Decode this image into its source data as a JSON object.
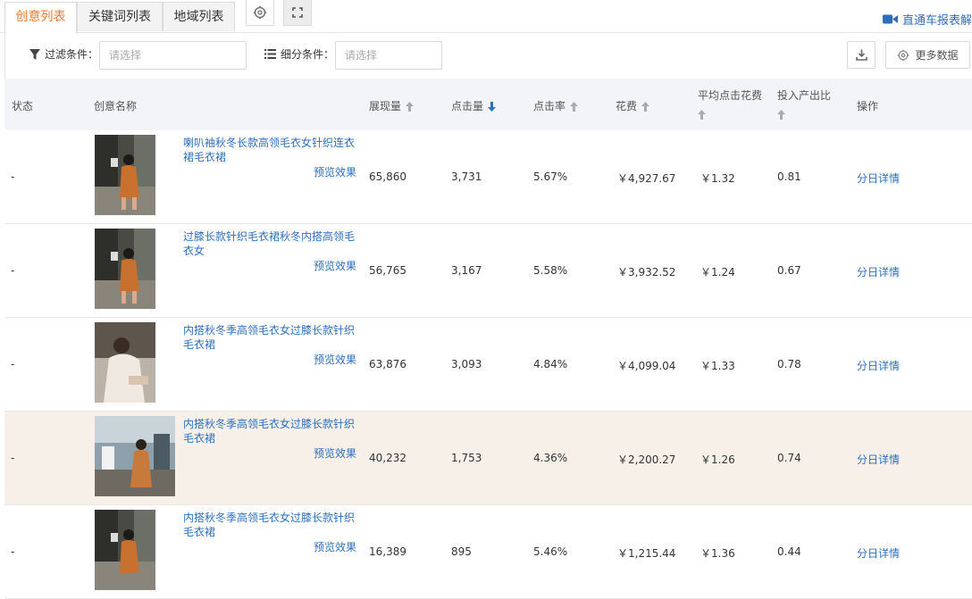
{
  "tabs": [
    {
      "label": "创意列表",
      "active": true
    },
    {
      "label": "关键词列表",
      "active": false
    },
    {
      "label": "地域列表",
      "active": false
    }
  ],
  "report_link": "直通车报表解读",
  "filters": {
    "filter_label": "过滤条件：",
    "filter_placeholder": "请选择",
    "segment_label": "细分条件：",
    "segment_placeholder": "请选择",
    "more_data_label": "更多数据"
  },
  "table": {
    "headers": {
      "status": "状态",
      "name": "创意名称",
      "impressions": "展现量",
      "clicks": "点击量",
      "ctr": "点击率",
      "cost": "花费",
      "cpc": "平均点击花费",
      "roi": "投入产出比",
      "action": "操作"
    },
    "rows": [
      {
        "status": "-",
        "title": "喇叭袖秋冬长款高领毛衣女针织连衣裙毛衣裙",
        "preview": "预览效果",
        "impressions": "65,860",
        "clicks": "3,731",
        "ctr": "5.67%",
        "cost": "￥4,927.67",
        "cpc": "￥1.32",
        "roi": "0.81",
        "action": "分日详情"
      },
      {
        "status": "-",
        "title": "过膝长款针织毛衣裙秋冬内搭高领毛衣女",
        "preview": "预览效果",
        "impressions": "56,765",
        "clicks": "3,167",
        "ctr": "5.58%",
        "cost": "￥3,932.52",
        "cpc": "￥1.24",
        "roi": "0.67",
        "action": "分日详情"
      },
      {
        "status": "-",
        "title": "内搭秋冬季高领毛衣女过膝长款针织毛衣裙",
        "preview": "预览效果",
        "impressions": "63,876",
        "clicks": "3,093",
        "ctr": "4.84%",
        "cost": "￥4,099.04",
        "cpc": "￥1.33",
        "roi": "0.78",
        "action": "分日详情"
      },
      {
        "status": "-",
        "title": "内搭秋冬季高领毛衣女过膝长款针织毛衣裙",
        "preview": "预览效果",
        "impressions": "40,232",
        "clicks": "1,753",
        "ctr": "4.36%",
        "cost": "￥2,200.27",
        "cpc": "￥1.26",
        "roi": "0.74",
        "action": "分日详情"
      },
      {
        "status": "-",
        "title": "内搭秋冬季高领毛衣女过膝长款针织毛衣裙",
        "preview": "预览效果",
        "impressions": "16,389",
        "clicks": "895",
        "ctr": "5.46%",
        "cost": "￥1,215.44",
        "cpc": "￥1.36",
        "roi": "0.44",
        "action": "分日详情"
      }
    ]
  },
  "colors": {
    "accent": "#ee7a2e",
    "link": "#2d6fbd",
    "sort_active": "#2d6fbd",
    "highlight_row": "#f6f0e8"
  }
}
